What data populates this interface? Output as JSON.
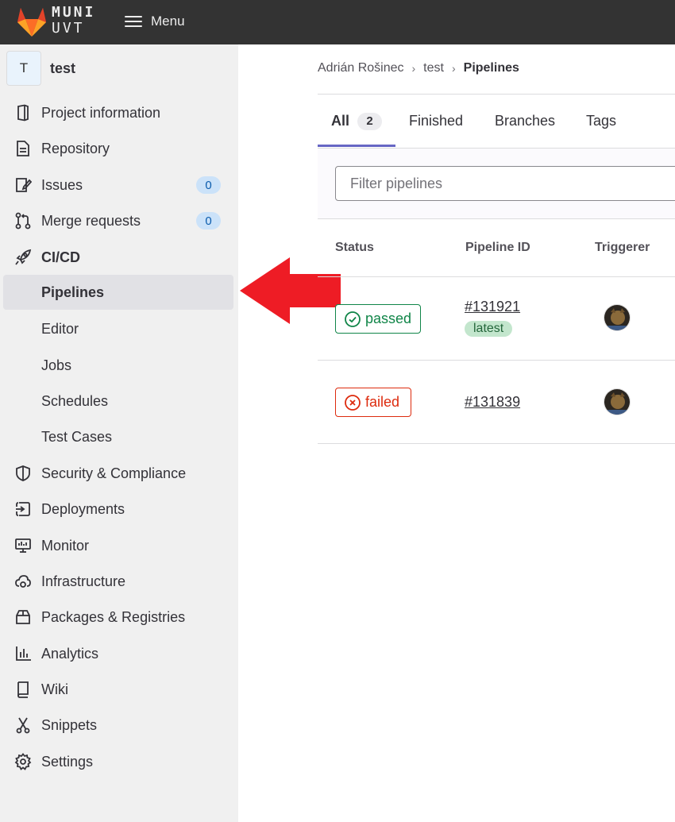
{
  "topbar": {
    "logo_line1": "MUNI",
    "logo_line2": "UVT",
    "menu_label": "Menu"
  },
  "project": {
    "avatar_letter": "T",
    "name": "test"
  },
  "sidebar": {
    "items": [
      {
        "label": "Project information",
        "icon": "project-icon"
      },
      {
        "label": "Repository",
        "icon": "doc-icon"
      },
      {
        "label": "Issues",
        "icon": "issues-icon",
        "count": "0"
      },
      {
        "label": "Merge requests",
        "icon": "merge-request-icon",
        "count": "0"
      },
      {
        "label": "CI/CD",
        "icon": "rocket-icon"
      },
      {
        "label": "Security & Compliance",
        "icon": "shield-icon"
      },
      {
        "label": "Deployments",
        "icon": "deployments-icon"
      },
      {
        "label": "Monitor",
        "icon": "monitor-icon"
      },
      {
        "label": "Infrastructure",
        "icon": "cloud-gear-icon"
      },
      {
        "label": "Packages & Registries",
        "icon": "package-icon"
      },
      {
        "label": "Analytics",
        "icon": "chart-icon"
      },
      {
        "label": "Wiki",
        "icon": "book-icon"
      },
      {
        "label": "Snippets",
        "icon": "scissors-icon"
      },
      {
        "label": "Settings",
        "icon": "gear-icon"
      }
    ],
    "cicd_sub": [
      "Pipelines",
      "Editor",
      "Jobs",
      "Schedules",
      "Test Cases"
    ]
  },
  "breadcrumb": {
    "user": "Adrián Rošinec",
    "project": "test",
    "current": "Pipelines"
  },
  "tabs": [
    {
      "label": "All",
      "count": "2"
    },
    {
      "label": "Finished"
    },
    {
      "label": "Branches"
    },
    {
      "label": "Tags"
    }
  ],
  "filter": {
    "placeholder": "Filter pipelines"
  },
  "table": {
    "headers": [
      "Status",
      "Pipeline ID",
      "Triggerer"
    ],
    "rows": [
      {
        "status": "passed",
        "pipeline_id": "#131921",
        "badge": "latest"
      },
      {
        "status": "failed",
        "pipeline_id": "#131839"
      }
    ]
  },
  "colors": {
    "topbar": "#333333",
    "sidebar": "#f0f0f0",
    "passed": "#108548",
    "failed": "#dd2b0e",
    "arrow": "#ee1c25",
    "tab_underline": "#6666c4"
  }
}
